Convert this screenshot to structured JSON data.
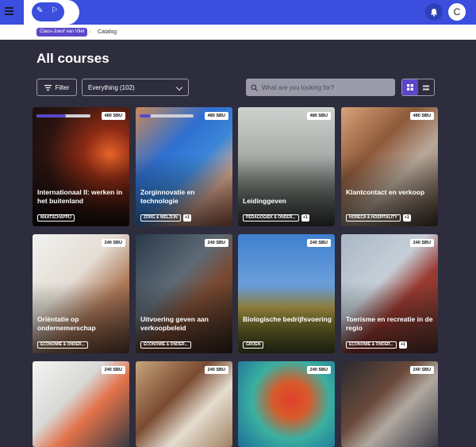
{
  "header": {
    "avatar_initial": "C"
  },
  "breadcrumb": {
    "user": "Claus-Joesf van Vliet",
    "separator": "›",
    "current": "Catalog"
  },
  "page": {
    "title": "All courses"
  },
  "filters": {
    "filter_label": "Filter",
    "select_value": "Everything (102)",
    "search_placeholder": "What are you looking for?"
  },
  "courses": [
    {
      "sbu": "480 SBU",
      "title": "Internationaal II: werken in het buitenland",
      "tag": "MAATSCHAPPIJ",
      "extra": "",
      "progress": 0.55,
      "img": "a"
    },
    {
      "sbu": "480 SBU",
      "title": "Zorginnovatie en technologie",
      "tag": "ZORG & WELZIJN",
      "extra": "+1",
      "progress": 0.2,
      "img": "b"
    },
    {
      "sbu": "480 SBU",
      "title": "Leidinggeven",
      "tag": "PEDAGOGIEK & ONDER...",
      "extra": "+1",
      "progress": null,
      "img": "c"
    },
    {
      "sbu": "480 SBU",
      "title": "Klantcontact en verkoop",
      "tag": "HORECA & HOSPITALITY",
      "extra": "+1",
      "progress": null,
      "img": "d"
    },
    {
      "sbu": "240 SBU",
      "title": "Oriëntatie op ondernemerschap",
      "tag": "ECONOMIE & ONDER...",
      "extra": "",
      "progress": null,
      "img": "e"
    },
    {
      "sbu": "240 SBU",
      "title": "Uitvoering geven aan verkoopbeleid",
      "tag": "ECONOMIE & ONDER...",
      "extra": "",
      "progress": null,
      "img": "f"
    },
    {
      "sbu": "240 SBU",
      "title": "Biologische bedrijfsvoering",
      "tag": "GROEN",
      "extra": "",
      "progress": null,
      "img": "g"
    },
    {
      "sbu": "240 SBU",
      "title": "Toerisme en recreatie in de regio",
      "tag": "ECONOMIE & ONDER...",
      "extra": "+1",
      "progress": null,
      "img": "h"
    },
    {
      "sbu": "240 SBU",
      "title": "",
      "tag": "",
      "extra": "",
      "progress": null,
      "img": "i"
    },
    {
      "sbu": "240 SBU",
      "title": "",
      "tag": "",
      "extra": "",
      "progress": null,
      "img": "j"
    },
    {
      "sbu": "240 SBU",
      "title": "",
      "tag": "",
      "extra": "",
      "progress": null,
      "img": "k"
    },
    {
      "sbu": "240 SBU",
      "title": "",
      "tag": "",
      "extra": "",
      "progress": null,
      "img": "l"
    }
  ],
  "colors": {
    "brand": "#3b4ede",
    "accent": "#5a47c9",
    "background": "#2d2d3d"
  }
}
